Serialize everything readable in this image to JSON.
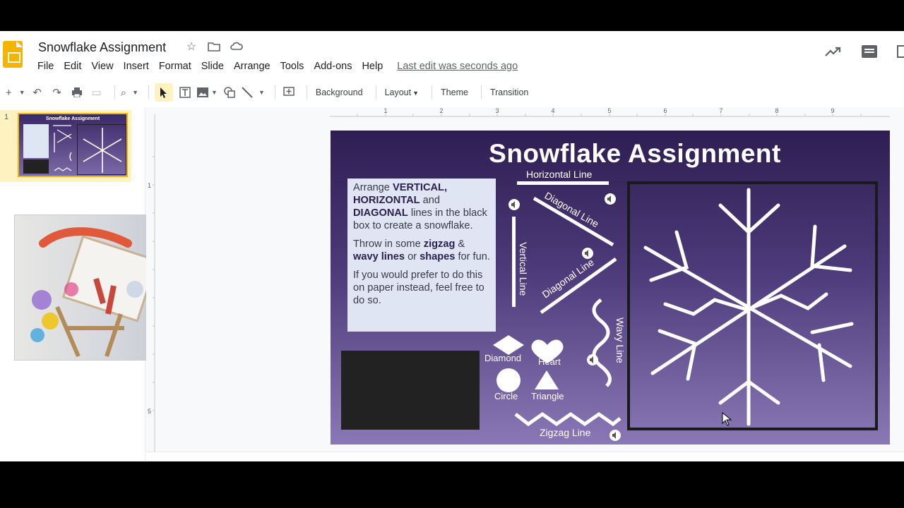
{
  "header": {
    "title": "Snowflake Assignment",
    "menu": [
      "File",
      "Edit",
      "View",
      "Insert",
      "Format",
      "Slide",
      "Arrange",
      "Tools",
      "Add-ons",
      "Help"
    ],
    "last_edit": "Last edit was seconds ago"
  },
  "toolbar": {
    "background": "Background",
    "layout": "Layout",
    "theme": "Theme",
    "transition": "Transition"
  },
  "filmstrip": {
    "slide_number": "1",
    "thumb_title": "Snowflake Assignment"
  },
  "ruler": {
    "ticks": [
      "1",
      "2",
      "3",
      "4",
      "5",
      "6",
      "7",
      "8",
      "9"
    ],
    "left_ticks": [
      "1",
      "5"
    ]
  },
  "slide": {
    "title": "Snowflake Assignment",
    "info": {
      "p1_a": "Arrange ",
      "p1_b": "VERTICAL, HORIZONTAL",
      "p1_c": " and ",
      "p1_d": "DIAGONAL",
      "p1_e": " lines in the black box to create a snowflake.",
      "p2_a": "Throw in some ",
      "p2_b": "zigzag",
      "p2_c": " & ",
      "p2_d": "wavy lines",
      "p2_e": " or ",
      "p2_f": "shapes",
      "p2_g": " for fun.",
      "p3": "If you would prefer to do this on paper instead, feel free to do so."
    },
    "labels": {
      "horizontal": "Horizontal Line",
      "diagonal1": "Diagonal Line",
      "diagonal2": "Diagonal Line",
      "vertical": "Vertical Line",
      "wavy": "Wavy Line",
      "zigzag": "Zigzag Line",
      "diamond": "Diamond",
      "heart": "Heart",
      "circle": "Circle",
      "triangle": "Triangle"
    }
  },
  "colors": {
    "accent_yellow": "#f4b400",
    "slide_top": "#2f1e52",
    "slide_bottom": "#8a78b6",
    "info_box": "#dfe5f2"
  }
}
